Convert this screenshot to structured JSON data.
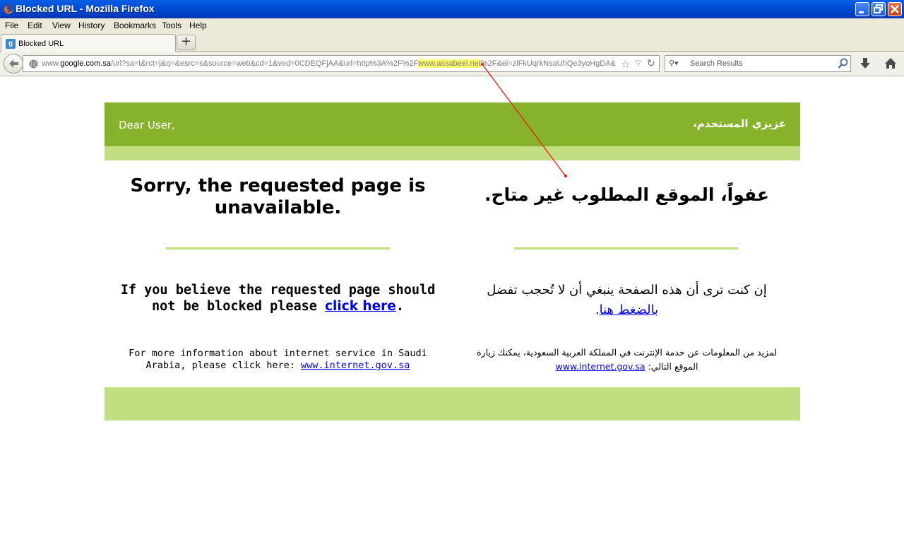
{
  "window": {
    "title": "Blocked URL - Mozilla Firefox"
  },
  "menu": [
    {
      "label": "File"
    },
    {
      "label": "Edit"
    },
    {
      "label": "View"
    },
    {
      "label": "History"
    },
    {
      "label": "Bookmarks"
    },
    {
      "label": "Tools"
    },
    {
      "label": "Help"
    }
  ],
  "tab": {
    "title": "Blocked URL",
    "new_tab": "+"
  },
  "address": {
    "url_prefix": "www.",
    "url_domain": "google.com.sa",
    "url_path_1": "/url?sa=t&rct=j&q=&esrc=s&source=web&cd=1&ved=0CDEQFjAA&url=http%3A%2F%2F",
    "url_highlight": "www.assabeel.net",
    "url_path_2": "%2F&ei=ziFkUqrkNsaUhQe3yoHgDA&"
  },
  "search": {
    "placeholder": "Search Results"
  },
  "page": {
    "greeting_en": "Dear User,",
    "greeting_ar": "عزيزي المستخدم،",
    "sorry_en": "Sorry, the requested page is unavailable.",
    "sorry_ar": "عفواً، الموقع المطلوب غير متاح.",
    "believe_en_text": "If you believe the requested page should not be blocked please ",
    "believe_en_link": "click here",
    "believe_en_end": ".",
    "believe_ar_text": "إن كنت ترى أن هذه الصفحة ينبغي أن لا تُحجب تفضل ",
    "believe_ar_link": "بالضغط هنا",
    "believe_ar_end": ".",
    "info_en_text": "For more information about internet service in Saudi Arabia, please click here: ",
    "info_en_link": "www.internet.gov.sa",
    "info_ar_text": "لمزيد من المعلومات عن خدمة الإنترنت في المملكة العربية السعودية، يمكنك زيارة الموقع التالي: ",
    "info_ar_link": "www.internet.gov.sa"
  },
  "colors": {
    "header_green": "#87b32c",
    "light_green": "#c1df81",
    "link_blue": "#0000ee",
    "url_highlight": "#ffff6e",
    "annotation_red": "#e8231f"
  }
}
